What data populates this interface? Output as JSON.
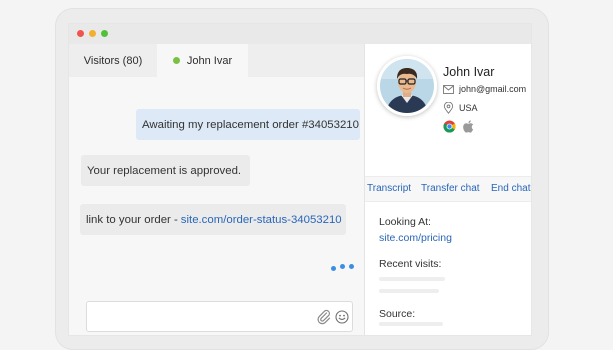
{
  "tabs": {
    "visitors_label": "Visitors (80)",
    "active_chat_label": "John Ivar"
  },
  "messages": [
    {
      "from": "visitor",
      "text": "Awaiting my replacement order #34053210"
    },
    {
      "from": "agent",
      "text": "Your replacement is approved."
    },
    {
      "from": "agent",
      "text": "link to your order - ",
      "link": "site.com/order-status-34053210"
    }
  ],
  "composer": {
    "placeholder": "",
    "value": ""
  },
  "visitor": {
    "name": "John Ivar",
    "email": "john@gmail.com",
    "country": "USA",
    "browsers": [
      "chrome-icon",
      "apple-icon"
    ]
  },
  "actions": {
    "transcript": "Transcript",
    "transfer": "Transfer chat",
    "end": "End chat"
  },
  "details": {
    "looking_at_label": "Looking At:",
    "looking_at_url": "site.com/pricing",
    "recent_visits_label": "Recent visits:",
    "source_label": "Source:"
  },
  "colors": {
    "accent": "#2966b8",
    "online": "#7ac143",
    "visitor_bubble": "#dde9f6",
    "agent_bubble": "#ebebeb",
    "typing": "#3c8fe0"
  }
}
